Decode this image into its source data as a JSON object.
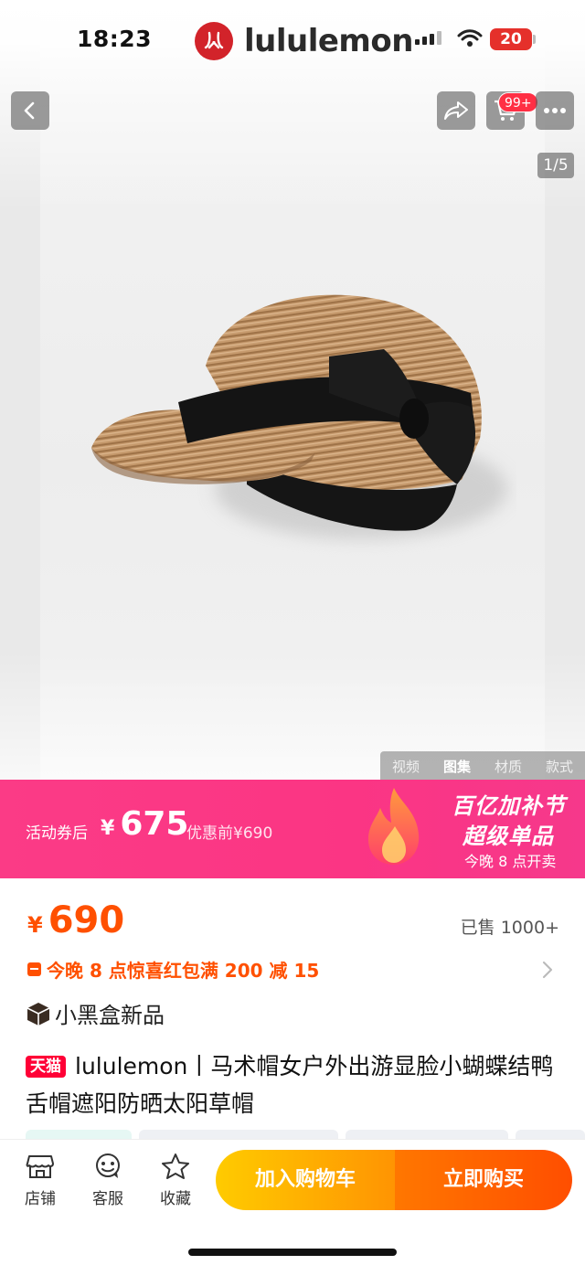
{
  "status_bar": {
    "time": "18:23",
    "battery": "20"
  },
  "app": {
    "brand": "lululemon",
    "brand_color": "#d2232a"
  },
  "nav": {
    "cart_badge": "99+",
    "image_counter": "1/5"
  },
  "media_tabs": [
    {
      "label": "视频",
      "active": false
    },
    {
      "label": "图集",
      "active": true
    },
    {
      "label": "材质",
      "active": false
    },
    {
      "label": "款式",
      "active": false
    }
  ],
  "promo": {
    "label": "活动券后",
    "currency": "¥",
    "price": "675",
    "original": "优惠前¥690",
    "title": "百亿加补节",
    "subtitle": "超级单品",
    "time": "今晚 8 点开卖",
    "bg_color": "#fb3b86"
  },
  "product": {
    "currency": "¥",
    "price": "690",
    "sold": "已售 1000+",
    "coupon": "今晚 8 点惊喜红包满 200 减 15",
    "tag": "小黑盒新品",
    "store_badge": "天猫",
    "title": "lululemon丨马术帽女户外出游显脸小蝴蝶结鸭舌帽遮阳防晒太阳草帽",
    "price_color": "#ff5000"
  },
  "bottom_bar": {
    "store": "店铺",
    "service": "客服",
    "favorite": "收藏",
    "add_to_cart": "加入购物车",
    "buy_now": "立即购买"
  }
}
